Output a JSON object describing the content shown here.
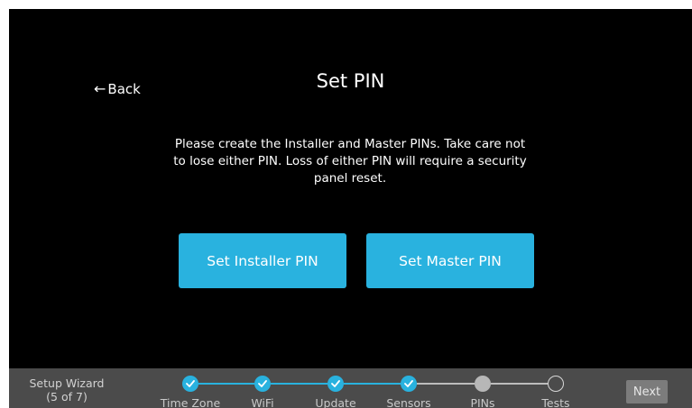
{
  "header": {
    "back_label": "Back",
    "title": "Set PIN"
  },
  "main": {
    "description": "Please create the Installer and Master PINs. Take care not to lose either PIN. Loss of either PIN will require a security panel reset.",
    "installer_button": "Set Installer PIN",
    "master_button": "Set Master PIN"
  },
  "footer": {
    "wizard_title": "Setup Wizard",
    "wizard_progress": "(5 of 7)",
    "steps": [
      {
        "label": "Time Zone",
        "state": "done"
      },
      {
        "label": "WiFi",
        "state": "done"
      },
      {
        "label": "Update",
        "state": "done"
      },
      {
        "label": "Sensors",
        "state": "done"
      },
      {
        "label": "PINs",
        "state": "current"
      },
      {
        "label": "Tests",
        "state": "todo"
      }
    ],
    "next_label": "Next"
  },
  "colors": {
    "accent": "#29b2df",
    "background": "#000000",
    "footer": "#4b4b4b",
    "step_current": "#b7b7b7",
    "next_button": "#7c7c7c"
  }
}
